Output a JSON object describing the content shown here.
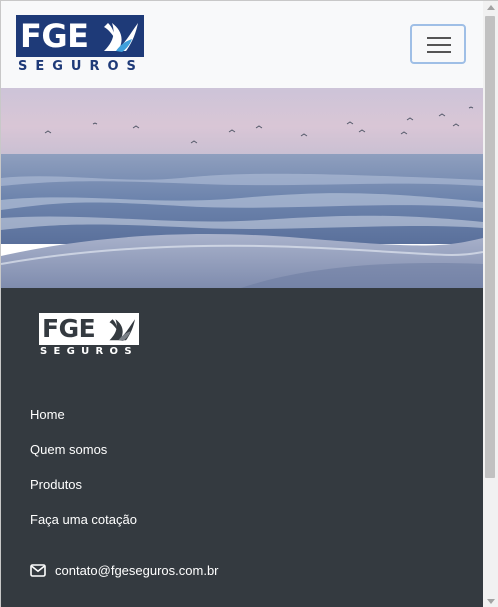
{
  "brand": {
    "logo_main": "FGE",
    "logo_sub": "SEGUROS",
    "color_primary": "#1e3a78",
    "color_footer": "#343a40"
  },
  "navbar": {
    "toggler_icon": "hamburger-menu-icon"
  },
  "hero": {
    "image": "beach-shoreline-at-dusk"
  },
  "footer": {
    "logo_main": "FGE",
    "logo_sub": "SEGUROS",
    "nav": [
      {
        "label": "Home"
      },
      {
        "label": "Quem somos"
      },
      {
        "label": "Produtos"
      },
      {
        "label": "Faça uma cotação"
      }
    ],
    "contact": {
      "icon": "envelope-icon",
      "email": "contato@fgeseguros.com.br"
    }
  }
}
